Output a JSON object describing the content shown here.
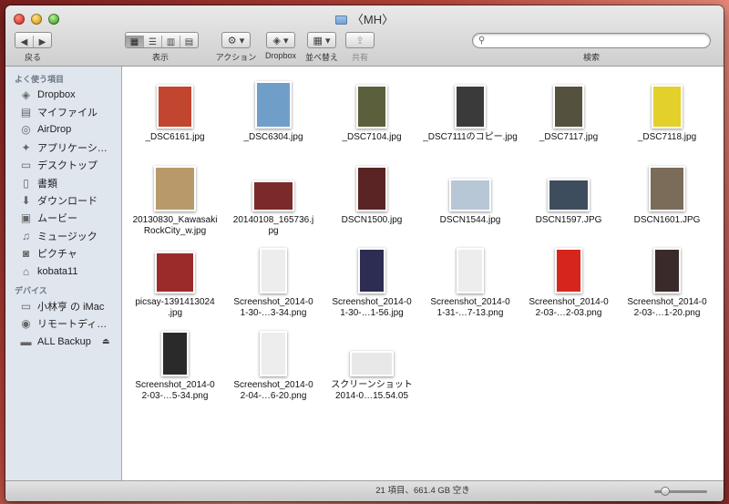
{
  "window": {
    "title": "〈MH〉"
  },
  "toolbar": {
    "back_label": "戻る",
    "view_label": "表示",
    "action_label": "アクション",
    "dropbox_label": "Dropbox",
    "arrange_label": "並べ替え",
    "share_label": "共有",
    "search_label": "検索",
    "search_placeholder": ""
  },
  "sidebar": {
    "favorites_header": "よく使う項目",
    "favorites": [
      {
        "label": "Dropbox",
        "icon": "dropbox-icon"
      },
      {
        "label": "マイファイル",
        "icon": "my-files-icon"
      },
      {
        "label": "AirDrop",
        "icon": "airdrop-icon"
      },
      {
        "label": "アプリケーシ…",
        "icon": "applications-icon"
      },
      {
        "label": "デスクトップ",
        "icon": "desktop-icon"
      },
      {
        "label": "書類",
        "icon": "documents-icon"
      },
      {
        "label": "ダウンロード",
        "icon": "downloads-icon"
      },
      {
        "label": "ムービー",
        "icon": "movies-icon"
      },
      {
        "label": "ミュージック",
        "icon": "music-icon"
      },
      {
        "label": "ピクチャ",
        "icon": "pictures-icon"
      },
      {
        "label": "kobata11",
        "icon": "home-icon"
      }
    ],
    "devices_header": "デバイス",
    "devices": [
      {
        "label": "小林亨 の iMac",
        "icon": "imac-icon"
      },
      {
        "label": "リモートディ…",
        "icon": "remote-disc-icon"
      },
      {
        "label": "ALL Backup",
        "icon": "drive-icon"
      }
    ]
  },
  "files": [
    {
      "name": "_DSC6161.jpg",
      "color": "#c2452f"
    },
    {
      "name": "_DSC6304.jpg",
      "color": "#6f9fc9"
    },
    {
      "name": "_DSC7104.jpg",
      "color": "#5c5f3b"
    },
    {
      "name": "_DSC7111のコピー.jpg",
      "color": "#3a3a3a"
    },
    {
      "name": "_DSC7117.jpg",
      "color": "#55513f"
    },
    {
      "name": "_DSC7118.jpg",
      "color": "#e3d02a"
    },
    {
      "name": "20130830_KawasakiRockCity_w.jpg",
      "color": "#b89a6a"
    },
    {
      "name": "20140108_165736.jpg",
      "color": "#7a2a2a"
    },
    {
      "name": "DSCN1500.jpg",
      "color": "#5a2424"
    },
    {
      "name": "DSCN1544.jpg",
      "color": "#b7c7d6"
    },
    {
      "name": "DSCN1597.JPG",
      "color": "#3e4d5e"
    },
    {
      "name": "DSCN1601.JPG",
      "color": "#7b6c5a"
    },
    {
      "name": "picsay-1391413024.jpg",
      "color": "#9b2b2b"
    },
    {
      "name": "Screenshot_2014-01-30-…3-34.png",
      "color": "#ededed"
    },
    {
      "name": "Screenshot_2014-01-30-…1-56.jpg",
      "color": "#2d2c52"
    },
    {
      "name": "Screenshot_2014-01-31-…7-13.png",
      "color": "#ededed"
    },
    {
      "name": "Screenshot_2014-02-03-…2-03.png",
      "color": "#d6251c"
    },
    {
      "name": "Screenshot_2014-02-03-…1-20.png",
      "color": "#3a2a2a"
    },
    {
      "name": "Screenshot_2014-02-03-…5-34.png",
      "color": "#2a2a2a"
    },
    {
      "name": "Screenshot_2014-02-04-…6-20.png",
      "color": "#ededed"
    },
    {
      "name": "スクリーンショット 2014-0…15.54.05",
      "color": "#e8e8e8"
    }
  ],
  "status": {
    "text": "21 項目、661.4 GB 空き"
  }
}
